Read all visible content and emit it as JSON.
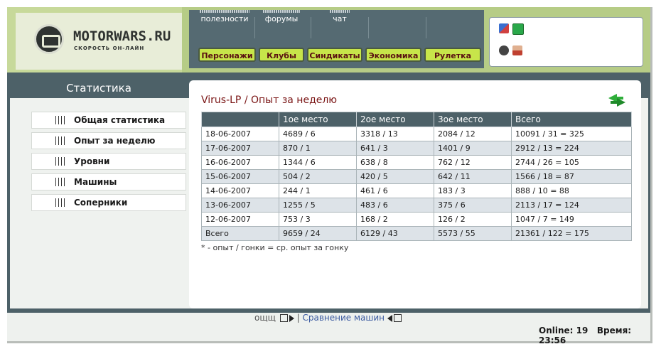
{
  "logo": {
    "name": "MOTORWARS.RU",
    "tagline": "СКОРОСТЬ ОН-ЛАЙН"
  },
  "top_nav": [
    {
      "label": "полезности"
    },
    {
      "label": "форумы"
    },
    {
      "label": "чат"
    }
  ],
  "nav_buttons": [
    {
      "label": "Персонажи"
    },
    {
      "label": "Клубы"
    },
    {
      "label": "Синдикаты"
    },
    {
      "label": "Экономика"
    },
    {
      "label": "Рулетка"
    }
  ],
  "sidebar": {
    "title": "Статистика",
    "items": [
      {
        "label": "Общая статистика"
      },
      {
        "label": "Опыт за неделю"
      },
      {
        "label": "Уровни"
      },
      {
        "label": "Машины"
      },
      {
        "label": "Соперники"
      }
    ]
  },
  "main": {
    "title": "Virus-LP / Опыт за неделю",
    "table": {
      "headers": [
        "",
        "1ое место",
        "2ое место",
        "3ое место",
        "Всего"
      ],
      "rows": [
        [
          "18-06-2007",
          "4689 / 6",
          "3318 / 13",
          "2084 / 12",
          "10091 / 31 = 325"
        ],
        [
          "17-06-2007",
          "870 / 1",
          "641 / 3",
          "1401 / 9",
          "2912 / 13 = 224"
        ],
        [
          "16-06-2007",
          "1344 / 6",
          "638 / 8",
          "762 / 12",
          "2744 / 26 = 105"
        ],
        [
          "15-06-2007",
          "504 / 2",
          "420 / 5",
          "642 / 11",
          "1566 / 18 = 87"
        ],
        [
          "14-06-2007",
          "244 / 1",
          "461 / 6",
          "183 / 3",
          "888 / 10 = 88"
        ],
        [
          "13-06-2007",
          "1255 / 5",
          "483 / 6",
          "375 / 6",
          "2113 / 17 = 124"
        ],
        [
          "12-06-2007",
          "753 / 3",
          "168 / 2",
          "126 / 2",
          "1047 / 7 = 149"
        ],
        [
          "Всего",
          "9659 / 24",
          "6129 / 43",
          "5573 / 55",
          "21361 / 122 = 175"
        ]
      ]
    },
    "note": "* - опыт / гонки = ср. опыт за гонку"
  },
  "footer": {
    "link1": "ощщ",
    "separator": "|",
    "link2": "Сравнение машин"
  },
  "status": {
    "online_label": "Online:",
    "online_value": "19",
    "time_label": "Время:",
    "time_value": "23:56"
  },
  "colors": {
    "accent_dark": "#4d6168",
    "header_green": "#b6cc86",
    "button_green": "#c7e54a",
    "title_red": "#7a1515"
  }
}
